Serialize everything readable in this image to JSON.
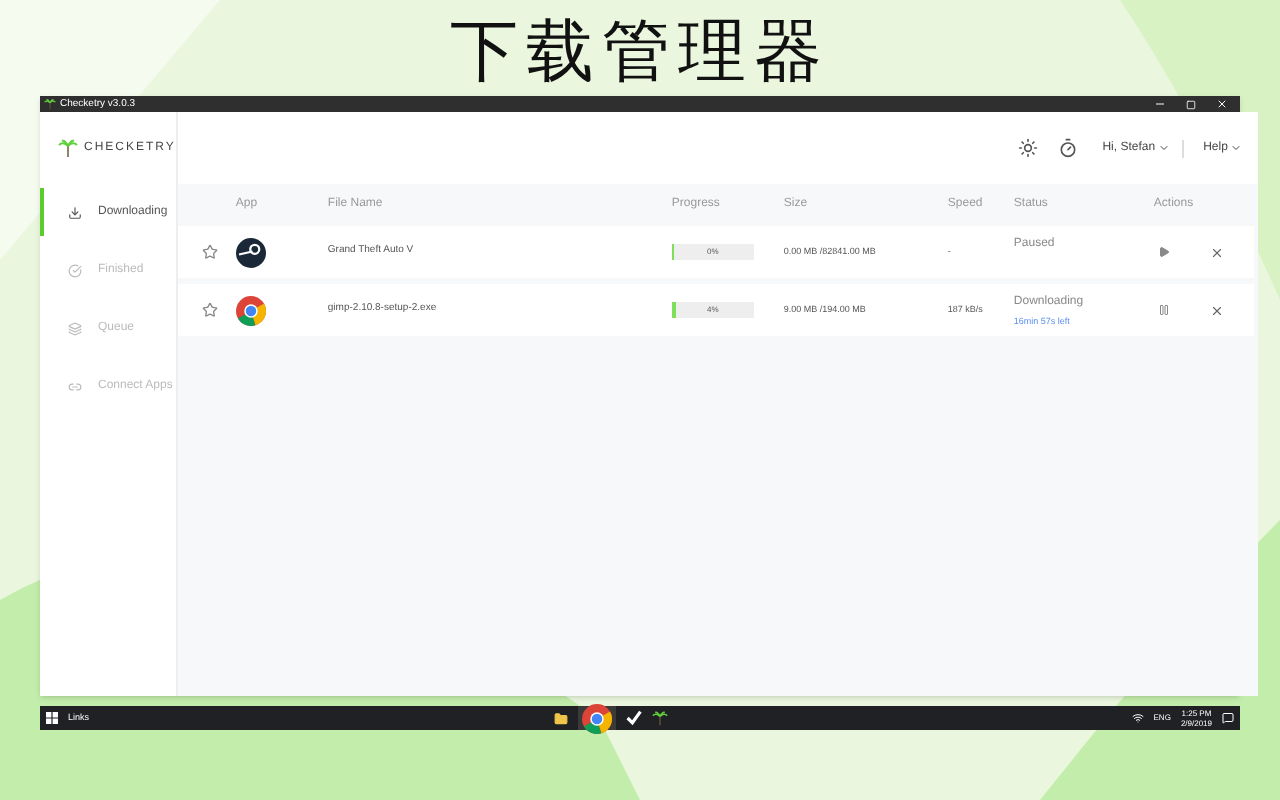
{
  "headline": "下载管理器",
  "window": {
    "title": "Checketry v3.0.3"
  },
  "brand": "CHECKETRY",
  "sidebar": {
    "items": [
      {
        "label": "Downloading",
        "selected": true
      },
      {
        "label": "Finished",
        "selected": false
      },
      {
        "label": "Queue",
        "selected": false
      },
      {
        "label": "Connect Apps",
        "selected": false
      }
    ]
  },
  "header": {
    "user": "Hi, Stefan",
    "help": "Help"
  },
  "table": {
    "columns": [
      "App",
      "File Name",
      "Progress",
      "Size",
      "Speed",
      "Status",
      "Actions"
    ],
    "rows": [
      {
        "name": "Grand Theft Auto V",
        "level": 0,
        "progress": "0%",
        "size": "0.00 MB /82841.00 MB",
        "speed": "-",
        "status": "Paused",
        "paused": true
      },
      {
        "name": "gimp-2.10.8-setup-2.exe",
        "level": 0.04,
        "progress": "4%",
        "size": "9.00 MB /194.00 MB",
        "speed": "187 kB/s",
        "status": "Downloading",
        "eta": "16min 57s left",
        "paused": false
      }
    ]
  },
  "taskbar": {
    "links": "Links",
    "lang": "ENG",
    "time": "1:25 PM",
    "date": "2/9/2019"
  }
}
